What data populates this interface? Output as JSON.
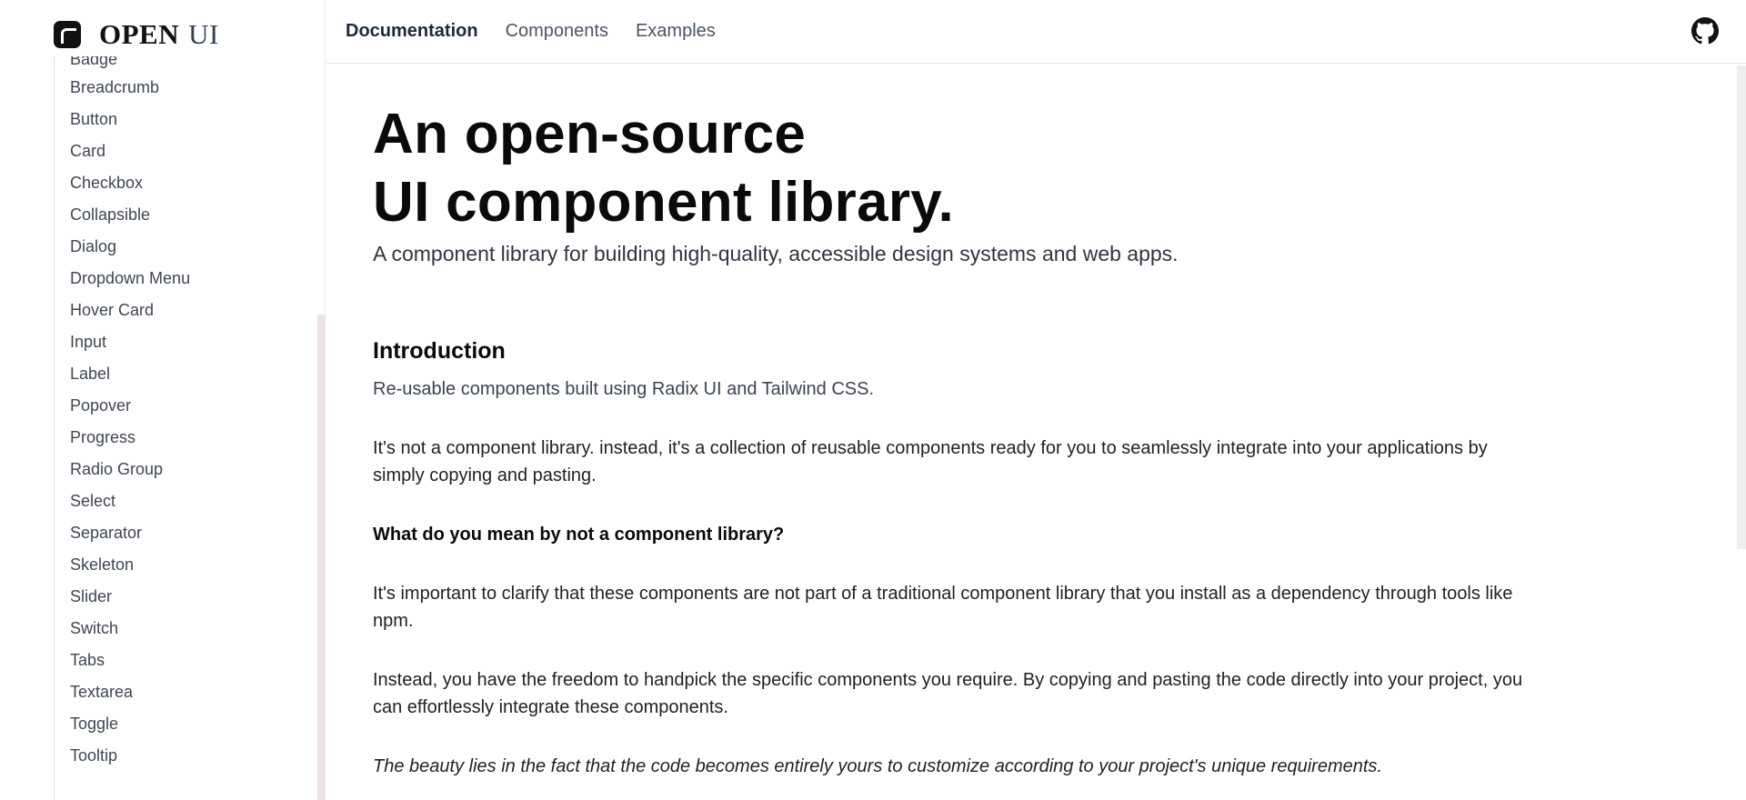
{
  "brand": {
    "name_bold": "OPEN",
    "name_light": "UI"
  },
  "sidebar": {
    "partial_item": "Badge",
    "items": [
      "Breadcrumb",
      "Button",
      "Card",
      "Checkbox",
      "Collapsible",
      "Dialog",
      "Dropdown Menu",
      "Hover Card",
      "Input",
      "Label",
      "Popover",
      "Progress",
      "Radio Group",
      "Select",
      "Separator",
      "Skeleton",
      "Slider",
      "Switch",
      "Tabs",
      "Textarea",
      "Toggle",
      "Tooltip"
    ]
  },
  "topnav": {
    "items": [
      "Documentation",
      "Components",
      "Examples"
    ],
    "active": "Documentation"
  },
  "main": {
    "title_line1": "An open-source",
    "title_line2": "UI component library.",
    "subtitle": "A component library for building high-quality, accessible design systems and web apps.",
    "section_title": "Introduction",
    "p1": "Re-usable components built using Radix UI and Tailwind CSS.",
    "p2": "It's not a component library. instead, it's a collection of reusable components ready for you to seamlessly integrate into your applications by simply copying and pasting.",
    "q1": "What do you mean by not a component library?",
    "p3": "It's important to clarify that these components are not part of a traditional component library that you install as a dependency through tools like npm.",
    "p4": "Instead, you have the freedom to handpick the specific components you require. By copying and pasting the code directly into your project, you can effortlessly integrate these components.",
    "p5": "The beauty lies in the fact that the code becomes entirely yours to customize according to your project's unique requirements."
  },
  "icons": {
    "logo": "open-ui-logo-icon",
    "github": "github-icon"
  }
}
